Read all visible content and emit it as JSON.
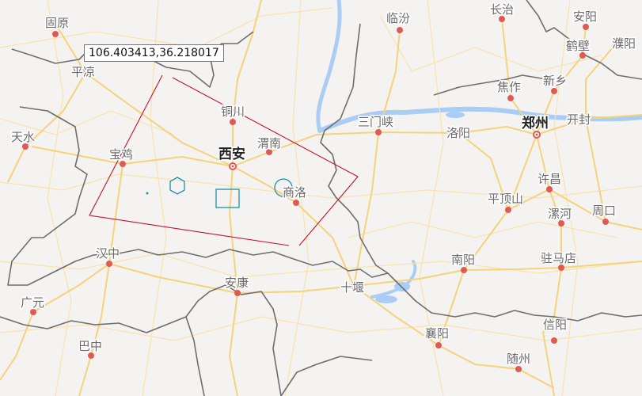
{
  "coordinate_tooltip": "106.403413,36.218017",
  "colors": {
    "land": "#f4f3f1",
    "water": "#aacdf5",
    "road_major": "#f6d27b",
    "road_minor": "#f9e3ad",
    "border": "#6e6e6e",
    "city_dot": "#e05a55",
    "polygon": "#c8102e",
    "overlay": "#1a8fb0"
  },
  "cities": [
    {
      "name": "固原",
      "major": false
    },
    {
      "name": "平凉",
      "major": false
    },
    {
      "name": "天水",
      "major": false
    },
    {
      "name": "宝鸡",
      "major": false
    },
    {
      "name": "铜川",
      "major": false
    },
    {
      "name": "西安",
      "major": true
    },
    {
      "name": "渭南",
      "major": false
    },
    {
      "name": "商洛",
      "major": false
    },
    {
      "name": "汉中",
      "major": false
    },
    {
      "name": "安康",
      "major": false
    },
    {
      "name": "广元",
      "major": false
    },
    {
      "name": "巴中",
      "major": false
    },
    {
      "name": "临汾",
      "major": false
    },
    {
      "name": "长治",
      "major": false
    },
    {
      "name": "安阳",
      "major": false
    },
    {
      "name": "鹤壁",
      "major": false
    },
    {
      "name": "濮阳",
      "major": false
    },
    {
      "name": "焦作",
      "major": false
    },
    {
      "name": "新乡",
      "major": false
    },
    {
      "name": "三门峡",
      "major": false
    },
    {
      "name": "郑州",
      "major": true
    },
    {
      "name": "开封",
      "major": false
    },
    {
      "name": "洛阳",
      "major": false
    },
    {
      "name": "许昌",
      "major": false
    },
    {
      "name": "平顶山",
      "major": false
    },
    {
      "name": "漯河",
      "major": false
    },
    {
      "name": "周口",
      "major": false
    },
    {
      "name": "南阳",
      "major": false
    },
    {
      "name": "驻马店",
      "major": false
    },
    {
      "name": "十堰",
      "major": false
    },
    {
      "name": "襄阳",
      "major": false
    },
    {
      "name": "信阳",
      "major": false
    },
    {
      "name": "随州",
      "major": false
    }
  ]
}
